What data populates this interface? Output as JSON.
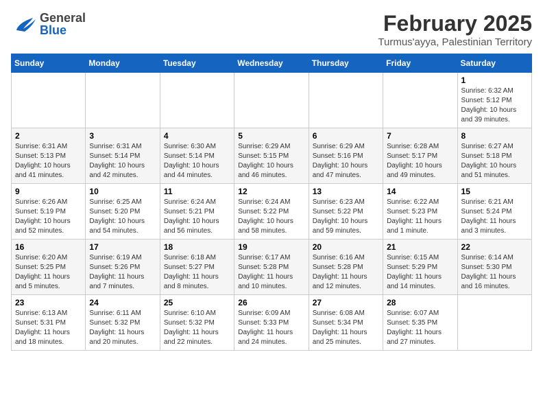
{
  "header": {
    "logo_general": "General",
    "logo_blue": "Blue",
    "title": "February 2025",
    "subtitle": "Turmus'ayya, Palestinian Territory"
  },
  "calendar": {
    "days_of_week": [
      "Sunday",
      "Monday",
      "Tuesday",
      "Wednesday",
      "Thursday",
      "Friday",
      "Saturday"
    ],
    "weeks": [
      [
        {
          "day": "",
          "info": ""
        },
        {
          "day": "",
          "info": ""
        },
        {
          "day": "",
          "info": ""
        },
        {
          "day": "",
          "info": ""
        },
        {
          "day": "",
          "info": ""
        },
        {
          "day": "",
          "info": ""
        },
        {
          "day": "1",
          "info": "Sunrise: 6:32 AM\nSunset: 5:12 PM\nDaylight: 10 hours and 39 minutes."
        }
      ],
      [
        {
          "day": "2",
          "info": "Sunrise: 6:31 AM\nSunset: 5:13 PM\nDaylight: 10 hours and 41 minutes."
        },
        {
          "day": "3",
          "info": "Sunrise: 6:31 AM\nSunset: 5:14 PM\nDaylight: 10 hours and 42 minutes."
        },
        {
          "day": "4",
          "info": "Sunrise: 6:30 AM\nSunset: 5:14 PM\nDaylight: 10 hours and 44 minutes."
        },
        {
          "day": "5",
          "info": "Sunrise: 6:29 AM\nSunset: 5:15 PM\nDaylight: 10 hours and 46 minutes."
        },
        {
          "day": "6",
          "info": "Sunrise: 6:29 AM\nSunset: 5:16 PM\nDaylight: 10 hours and 47 minutes."
        },
        {
          "day": "7",
          "info": "Sunrise: 6:28 AM\nSunset: 5:17 PM\nDaylight: 10 hours and 49 minutes."
        },
        {
          "day": "8",
          "info": "Sunrise: 6:27 AM\nSunset: 5:18 PM\nDaylight: 10 hours and 51 minutes."
        }
      ],
      [
        {
          "day": "9",
          "info": "Sunrise: 6:26 AM\nSunset: 5:19 PM\nDaylight: 10 hours and 52 minutes."
        },
        {
          "day": "10",
          "info": "Sunrise: 6:25 AM\nSunset: 5:20 PM\nDaylight: 10 hours and 54 minutes."
        },
        {
          "day": "11",
          "info": "Sunrise: 6:24 AM\nSunset: 5:21 PM\nDaylight: 10 hours and 56 minutes."
        },
        {
          "day": "12",
          "info": "Sunrise: 6:24 AM\nSunset: 5:22 PM\nDaylight: 10 hours and 58 minutes."
        },
        {
          "day": "13",
          "info": "Sunrise: 6:23 AM\nSunset: 5:22 PM\nDaylight: 10 hours and 59 minutes."
        },
        {
          "day": "14",
          "info": "Sunrise: 6:22 AM\nSunset: 5:23 PM\nDaylight: 11 hours and 1 minute."
        },
        {
          "day": "15",
          "info": "Sunrise: 6:21 AM\nSunset: 5:24 PM\nDaylight: 11 hours and 3 minutes."
        }
      ],
      [
        {
          "day": "16",
          "info": "Sunrise: 6:20 AM\nSunset: 5:25 PM\nDaylight: 11 hours and 5 minutes."
        },
        {
          "day": "17",
          "info": "Sunrise: 6:19 AM\nSunset: 5:26 PM\nDaylight: 11 hours and 7 minutes."
        },
        {
          "day": "18",
          "info": "Sunrise: 6:18 AM\nSunset: 5:27 PM\nDaylight: 11 hours and 8 minutes."
        },
        {
          "day": "19",
          "info": "Sunrise: 6:17 AM\nSunset: 5:28 PM\nDaylight: 11 hours and 10 minutes."
        },
        {
          "day": "20",
          "info": "Sunrise: 6:16 AM\nSunset: 5:28 PM\nDaylight: 11 hours and 12 minutes."
        },
        {
          "day": "21",
          "info": "Sunrise: 6:15 AM\nSunset: 5:29 PM\nDaylight: 11 hours and 14 minutes."
        },
        {
          "day": "22",
          "info": "Sunrise: 6:14 AM\nSunset: 5:30 PM\nDaylight: 11 hours and 16 minutes."
        }
      ],
      [
        {
          "day": "23",
          "info": "Sunrise: 6:13 AM\nSunset: 5:31 PM\nDaylight: 11 hours and 18 minutes."
        },
        {
          "day": "24",
          "info": "Sunrise: 6:11 AM\nSunset: 5:32 PM\nDaylight: 11 hours and 20 minutes."
        },
        {
          "day": "25",
          "info": "Sunrise: 6:10 AM\nSunset: 5:32 PM\nDaylight: 11 hours and 22 minutes."
        },
        {
          "day": "26",
          "info": "Sunrise: 6:09 AM\nSunset: 5:33 PM\nDaylight: 11 hours and 24 minutes."
        },
        {
          "day": "27",
          "info": "Sunrise: 6:08 AM\nSunset: 5:34 PM\nDaylight: 11 hours and 25 minutes."
        },
        {
          "day": "28",
          "info": "Sunrise: 6:07 AM\nSunset: 5:35 PM\nDaylight: 11 hours and 27 minutes."
        },
        {
          "day": "",
          "info": ""
        }
      ]
    ]
  }
}
